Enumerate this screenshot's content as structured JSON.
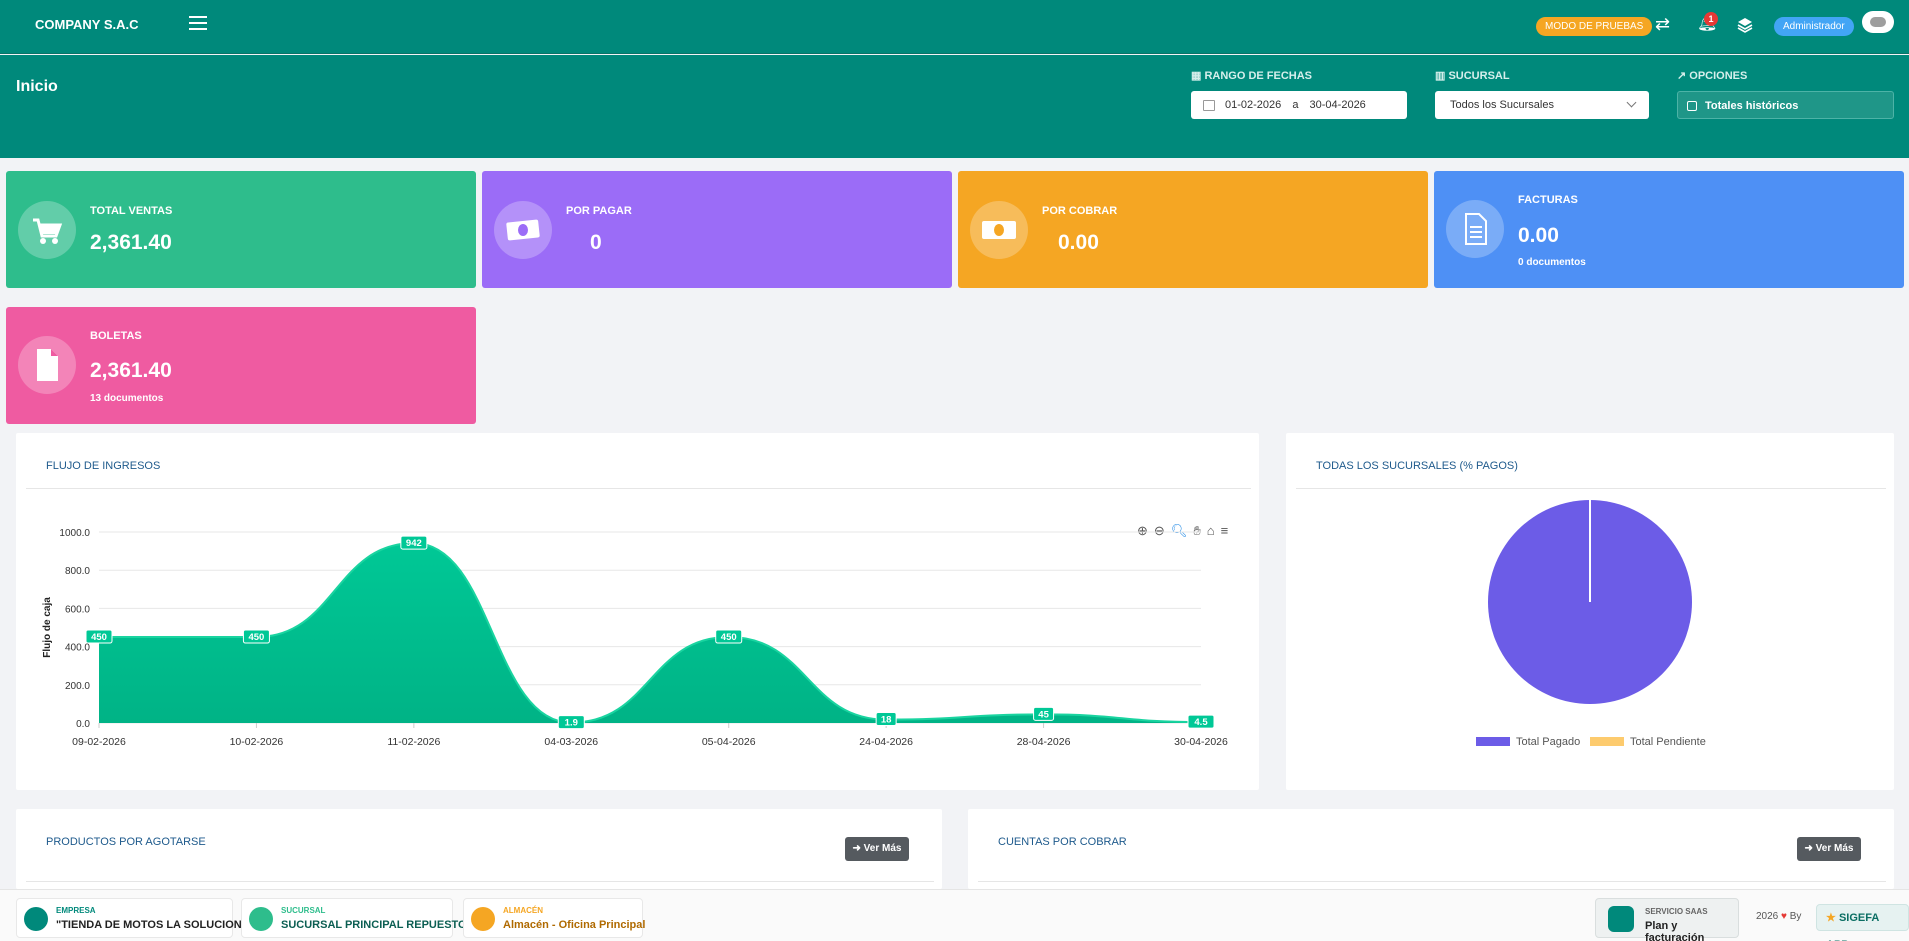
{
  "topbar": {
    "brand": "COMPANY S.A.C",
    "test_mode_label": "MODO DE PRUEBAS",
    "notification_count": "1",
    "user_label": "Administrador"
  },
  "header": {
    "title": "Inicio",
    "date_range_label": "RANGO DE FECHAS",
    "date_from": "01-02-2026",
    "date_sep": "a",
    "date_to": "30-04-2026",
    "branch_label": "SUCURSAL",
    "branch_value": "Todos los Sucursales",
    "options_label": "OPCIONES",
    "historic_totals_label": "Totales históricos"
  },
  "cards": {
    "total_ventas": {
      "title": "TOTAL VENTAS",
      "value": "2,361.40",
      "color": "#2ebd8c"
    },
    "por_pagar": {
      "title": "POR PAGAR",
      "value": "0",
      "color": "#9b6cf7"
    },
    "por_cobrar": {
      "title": "POR COBRAR",
      "value": "0.00",
      "color": "#f5a623"
    },
    "facturas": {
      "title": "FACTURAS",
      "value": "0.00",
      "sub": "0 documentos",
      "color": "#4e90f5"
    },
    "boletas": {
      "title": "BOLETAS",
      "value": "2,361.40",
      "sub": "13 documentos",
      "color": "#ef5ba1"
    }
  },
  "flujo": {
    "title": "FLUJO DE INGRESOS"
  },
  "chart_data": [
    {
      "type": "area",
      "ylabel": "Flujo de caja",
      "xlabel": "",
      "x": [
        "09-02-2026",
        "10-02-2026",
        "11-02-2026",
        "04-03-2026",
        "05-04-2026",
        "24-04-2026",
        "28-04-2026",
        "30-04-2026"
      ],
      "values": [
        450,
        450,
        942,
        1.9,
        450,
        18,
        45,
        4.5
      ],
      "data_labels": [
        "450",
        "450",
        "942",
        "1.9",
        "450",
        "18",
        "45",
        "4.5"
      ],
      "yticks": [
        "0.0",
        "200.0",
        "400.0",
        "600.0",
        "800.0",
        "1000.0"
      ],
      "ylim": [
        0,
        1000
      ],
      "grid": true,
      "color": "#00c896"
    },
    {
      "type": "pie",
      "title": "TODAS LOS SUCURSALES (% PAGOS)",
      "categories": [
        "Total Pagado",
        "Total Pendiente"
      ],
      "values": [
        100,
        0
      ],
      "colors": [
        "#6c5ce7",
        "#fdcb6e"
      ],
      "legend": "bottom"
    }
  ],
  "productos": {
    "title": "PRODUCTOS POR AGOTARSE",
    "button": "Ver Más"
  },
  "cuentas": {
    "title": "CUENTAS POR COBRAR",
    "button": "Ver Más"
  },
  "footer": {
    "empresa_label": "EMPRESA",
    "empresa_value": "\"TIENDA DE MOTOS LA SOLUCION\"",
    "sucursal_label": "SUCURSAL",
    "sucursal_value": "SUCURSAL PRINCIPAL REPUESTOS",
    "almacen_label": "ALMACÉN",
    "almacen_value": "Almacén - Oficina Principal",
    "saas_label": "SERVICIO SAAS",
    "saas_value": "Plan y facturación",
    "year": "2026",
    "by": "By",
    "app_label": "SIGEFA APP"
  }
}
